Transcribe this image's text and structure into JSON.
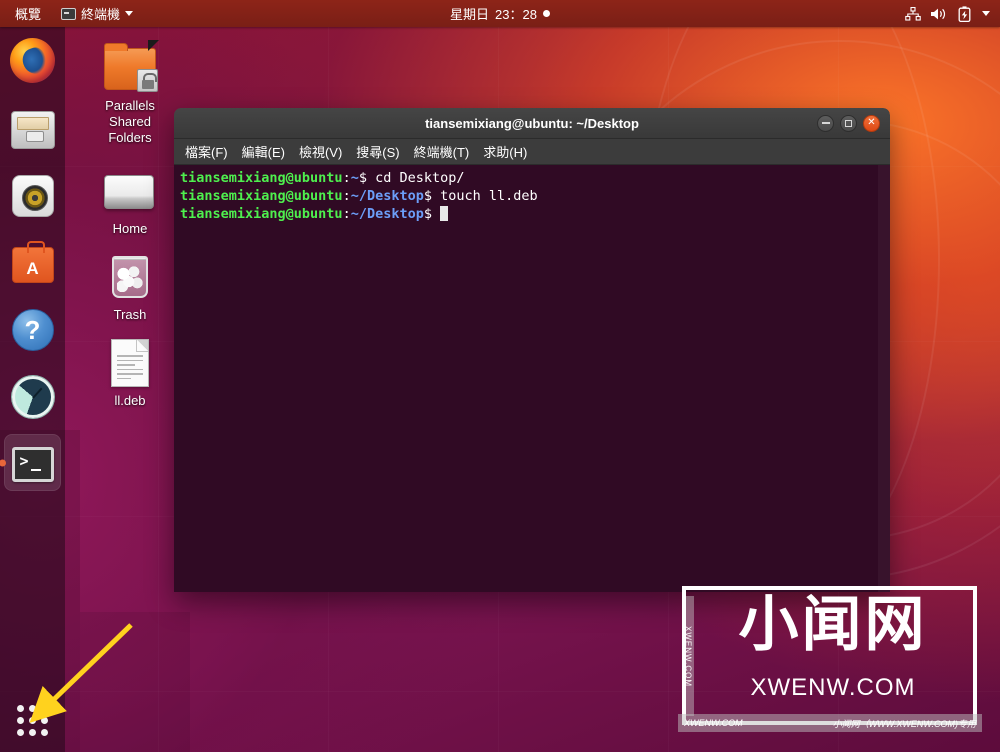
{
  "topbar": {
    "overview_label": "概覽",
    "app_menu_label": "終端機",
    "app_menu_icon": "terminal-icon",
    "clock_day": "星期日",
    "clock_time": "23：28",
    "notification_dot": "●",
    "tray": [
      {
        "name": "network-icon",
        "glyph": "network"
      },
      {
        "name": "volume-icon",
        "glyph": "volume"
      },
      {
        "name": "battery-icon",
        "glyph": "battery"
      },
      {
        "name": "chevron-down-icon",
        "glyph": "caret"
      }
    ]
  },
  "dock": {
    "items": [
      {
        "name": "firefox",
        "label": "Firefox Web Browser",
        "active": false
      },
      {
        "name": "files",
        "label": "Files",
        "active": false
      },
      {
        "name": "rhythmbox",
        "label": "Rhythmbox",
        "active": false
      },
      {
        "name": "ubuntu-software",
        "label": "Ubuntu Software",
        "active": false
      },
      {
        "name": "help",
        "label": "Help",
        "active": false
      },
      {
        "name": "disk-usage-analyzer",
        "label": "Disk Usage Analyzer",
        "active": false
      },
      {
        "name": "terminal",
        "label": "Terminal",
        "active": true
      }
    ],
    "show_apps_label": "顯示應用程式"
  },
  "desktop_icons": [
    {
      "name": "parallels-shared-folders",
      "label": "Parallels\nShared\nFolders",
      "type": "folder-locked"
    },
    {
      "name": "home",
      "label": "Home",
      "type": "drive"
    },
    {
      "name": "trash",
      "label": "Trash",
      "type": "trash"
    },
    {
      "name": "ll-deb",
      "label": "ll.deb",
      "type": "document"
    }
  ],
  "desktop_icon_labels": {
    "parallels": "Parallels Shared Folders",
    "parallels_l1": "Parallels",
    "parallels_l2": "Shared",
    "parallels_l3": "Folders",
    "home": "Home",
    "trash": "Trash",
    "deb": "ll.deb"
  },
  "terminal": {
    "title": "tiansemixiang@ubuntu: ~/Desktop",
    "menu": [
      {
        "name": "file",
        "label": "檔案(F)"
      },
      {
        "name": "edit",
        "label": "編輯(E)"
      },
      {
        "name": "view",
        "label": "檢視(V)"
      },
      {
        "name": "search",
        "label": "搜尋(S)"
      },
      {
        "name": "terminal",
        "label": "終端機(T)"
      },
      {
        "name": "help",
        "label": "求助(H)"
      }
    ],
    "window_buttons": {
      "minimize": "minimize-button",
      "maximize": "maximize-button",
      "close": "close-button"
    },
    "lines": [
      {
        "user": "tiansemixiang@ubuntu",
        "sep": ":",
        "path": "~",
        "prompt": "$",
        "command": " cd Desktop/"
      },
      {
        "user": "tiansemixiang@ubuntu",
        "sep": ":",
        "path": "~/Desktop",
        "prompt": "$",
        "command": " touch ll.deb"
      },
      {
        "user": "tiansemixiang@ubuntu",
        "sep": ":",
        "path": "~/Desktop",
        "prompt": "$",
        "command": " "
      }
    ],
    "line1_user": "tiansemixiang@ubuntu",
    "line1_path": "~",
    "line1_cmd": " cd Desktop/",
    "line2_user": "tiansemixiang@ubuntu",
    "line2_path": "~/Desktop",
    "line2_cmd": " touch ll.deb",
    "line3_user": "tiansemixiang@ubuntu",
    "line3_path": "~/Desktop",
    "prompt_symbol": "$",
    "colon": ":"
  },
  "watermark": {
    "cn_text": "小闻网",
    "en_text": "XWENW.COM",
    "side_text": "XWENW.COM",
    "footer_left": "XWENW.COM",
    "footer_right": "小闻网（WWW.XWENW.COM)专用"
  },
  "annotation": {
    "type": "arrow",
    "color": "#ffd21e",
    "points_to": "show-applications-button"
  },
  "colors": {
    "topbar_bg": "#2c0a14",
    "terminal_bg": "#300a24",
    "terminal_chrome": "#3c3c3c",
    "accent_orange": "#dd4814",
    "prompt_green": "#4ef04e",
    "path_blue": "#6c9ef8",
    "arrow_yellow": "#ffd21e"
  }
}
